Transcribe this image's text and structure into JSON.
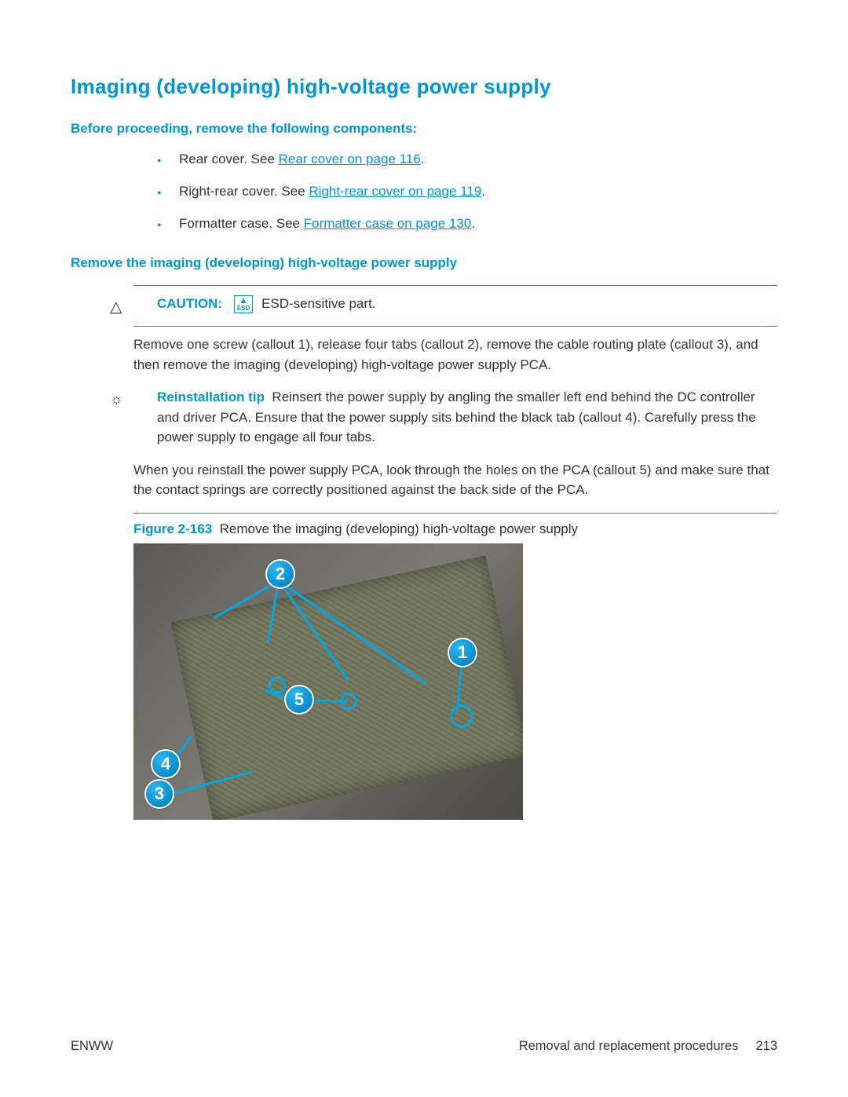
{
  "heading": "Imaging (developing) high-voltage power supply",
  "section1": {
    "title": "Before proceeding, remove the following components:",
    "items": [
      {
        "prefix": "Rear cover. See ",
        "link": "Rear cover on page 116",
        "suffix": "."
      },
      {
        "prefix": "Right-rear cover. See ",
        "link": "Right-rear cover on page 119",
        "suffix": "."
      },
      {
        "prefix": "Formatter case. See ",
        "link": "Formatter case on page 130",
        "suffix": "."
      }
    ]
  },
  "section2": {
    "title": "Remove the imaging (developing) high-voltage power supply",
    "caution_label": "CAUTION:",
    "esd_text": "ESD",
    "caution_text": "ESD-sensitive part.",
    "para1": "Remove one screw (callout 1), release four tabs (callout 2), remove the cable routing plate (callout 3), and then remove the imaging (developing) high-voltage power supply PCA.",
    "tip_label": "Reinstallation tip",
    "tip_text": "Reinsert the power supply by angling the smaller left end behind the DC controller and driver PCA. Ensure that the power supply sits behind the black tab (callout 4). Carefully press the power supply to engage all four tabs.",
    "para2": "When you reinstall the power supply PCA, look through the holes on the PCA (callout 5) and make sure that the contact springs are correctly positioned against the back side of the PCA.",
    "figure_num": "Figure 2-163",
    "figure_caption": "Remove the imaging (developing) high-voltage power supply",
    "callouts": [
      "1",
      "2",
      "3",
      "4",
      "5"
    ]
  },
  "footer": {
    "left": "ENWW",
    "right_text": "Removal and replacement procedures",
    "page": "213"
  }
}
